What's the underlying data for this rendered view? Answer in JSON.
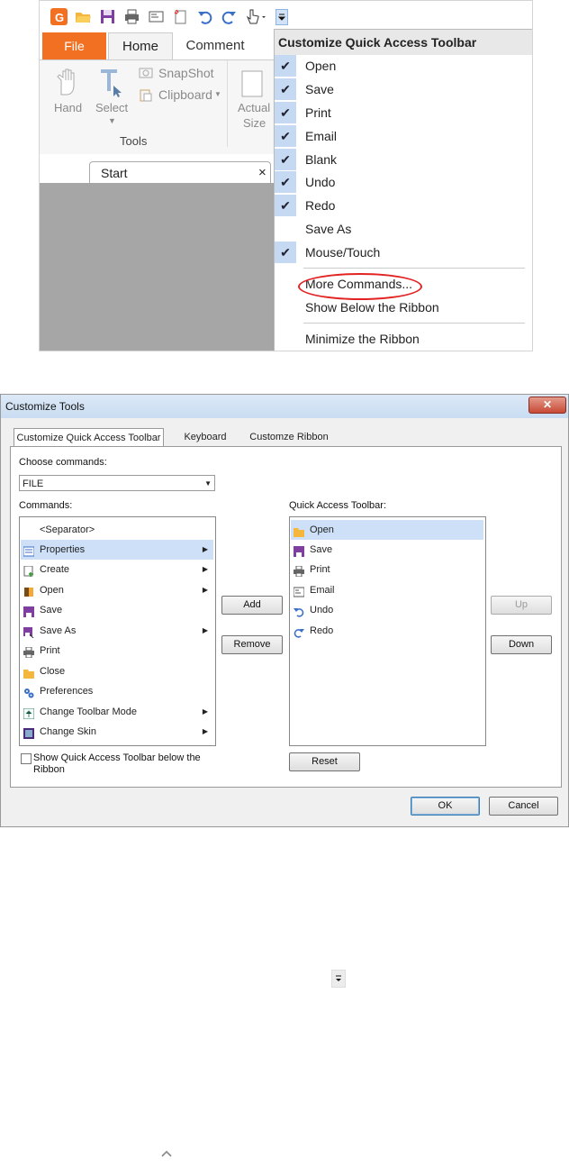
{
  "top_window": {
    "ribbon_tabs": {
      "file": "File",
      "home": "Home",
      "comment": "Comment"
    },
    "tools": {
      "hand": "Hand",
      "select": "Select",
      "snapshot": "SnapShot",
      "clipboard": "Clipboard",
      "group_label": "Tools",
      "actual": "Actual",
      "size": "Size"
    },
    "doc_tab": {
      "label": "Start",
      "close": "×"
    },
    "menu": {
      "title": "Customize Quick Access Toolbar",
      "items": [
        {
          "label": "Open",
          "checked": "✔"
        },
        {
          "label": "Save",
          "checked": "✔"
        },
        {
          "label": "Print",
          "checked": "✔"
        },
        {
          "label": "Email",
          "checked": "✔"
        },
        {
          "label": "Blank",
          "checked": "✔"
        },
        {
          "label": "Undo",
          "checked": "✔"
        },
        {
          "label": "Redo",
          "checked": "✔"
        },
        {
          "label": "Save As",
          "checked": ""
        },
        {
          "label": "Mouse/Touch",
          "checked": "✔"
        }
      ],
      "more_commands": "More Commands...",
      "show_below": "Show Below the Ribbon",
      "minimize": "Minimize the Ribbon"
    }
  },
  "dialog": {
    "title": "Customize Tools",
    "close": "✕",
    "tabs": [
      "Customize Quick Access Toolbar",
      "Keyboard",
      "Customze Ribbon"
    ],
    "choose_label": "Choose commands:",
    "choose_value": "FILE",
    "commands_label": "Commands:",
    "commands": [
      {
        "label": "<Separator>",
        "arrow": ""
      },
      {
        "label": "Properties",
        "arrow": "▶"
      },
      {
        "label": "Create",
        "arrow": "▶"
      },
      {
        "label": "Open",
        "arrow": "▶"
      },
      {
        "label": "Save",
        "arrow": ""
      },
      {
        "label": "Save As",
        "arrow": "▶"
      },
      {
        "label": "Print",
        "arrow": ""
      },
      {
        "label": "Close",
        "arrow": ""
      },
      {
        "label": "Preferences",
        "arrow": ""
      },
      {
        "label": "Change Toolbar Mode",
        "arrow": "▶"
      },
      {
        "label": "Change Skin",
        "arrow": "▶"
      }
    ],
    "qat_label": "Quick Access Toolbar:",
    "qat_items": [
      "Open",
      "Save",
      "Print",
      "Email",
      "Undo",
      "Redo"
    ],
    "add": "Add",
    "remove": "Remove",
    "up": "Up",
    "down": "Down",
    "reset": "Reset",
    "show_below_1": "Show Quick Access Toolbar below the",
    "show_below_2": "Ribbon",
    "ok": "OK",
    "cancel": "Cancel"
  },
  "colors": {
    "accent": "#f27021",
    "check_bg": "#c5daf2",
    "sel_bg": "#cde0f7",
    "highlight": "#e32222"
  }
}
